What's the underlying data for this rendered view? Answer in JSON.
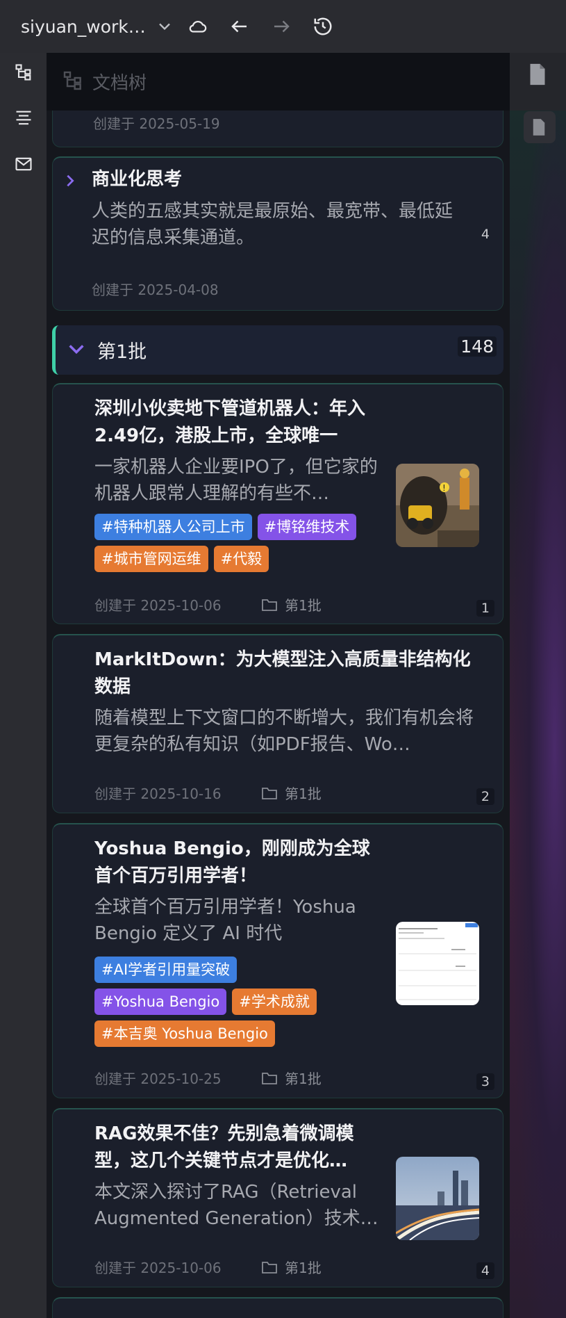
{
  "topbar": {
    "workspace_name": "siyuan_workspace",
    "workspace_name_display": "siyuan_worksp…"
  },
  "panel": {
    "title": "文档树"
  },
  "cards_top": [
    {
      "date": "创建于 2025-05-19"
    },
    {
      "title": "商业化思考",
      "desc": "人类的五感其实就是最原始、最宽带、最低延迟的信息采集通道。",
      "count": "4",
      "date": "创建于 2025-04-08"
    }
  ],
  "group": {
    "label": "第1批",
    "count": "148"
  },
  "cards": [
    {
      "title": "深圳小伙卖地下管道机器人：年入2.49亿，港股上市，全球唯一",
      "desc": "一家机器人企业要IPO了，但它家的机器人跟常人理解的有些不…",
      "tags": [
        {
          "text": "#特种机器人公司上市",
          "color": "blue"
        },
        {
          "text": "#博铭维技术",
          "color": "purple"
        },
        {
          "text": "#城市管网运维",
          "color": "orange"
        },
        {
          "text": "#代毅",
          "color": "orange"
        }
      ],
      "date": "创建于 2025-10-06",
      "folder": "第1批",
      "count": "1"
    },
    {
      "title": "MarkItDown：为大模型注入高质量非结构化数据",
      "desc": "随着模型上下文窗口的不断增大，我们有机会将更复杂的私有知识（如PDF报告、Wo…",
      "date": "创建于 2025-10-16",
      "folder": "第1批",
      "count": "2"
    },
    {
      "title": "Yoshua Bengio，刚刚成为全球首个百万引用学者！",
      "desc": "全球首个百万引用学者！Yoshua Bengio 定义了 AI 时代",
      "tags": [
        {
          "text": "#AI学者引用量突破",
          "color": "blue"
        },
        {
          "text": "#Yoshua Bengio",
          "color": "purple"
        },
        {
          "text": "#学术成就",
          "color": "orange"
        },
        {
          "text": "#本吉奥 Yoshua Bengio",
          "color": "orange"
        }
      ],
      "date": "创建于 2025-10-25",
      "folder": "第1批",
      "count": "3"
    },
    {
      "title": "RAG效果不佳？先别急着微调模型，这几个关键节点才是优化…",
      "desc": "本文深入探讨了RAG（Retrieval Augmented Generation）技术…",
      "date": "创建于 2025-10-06",
      "folder": "第1批",
      "count": "4"
    }
  ]
}
